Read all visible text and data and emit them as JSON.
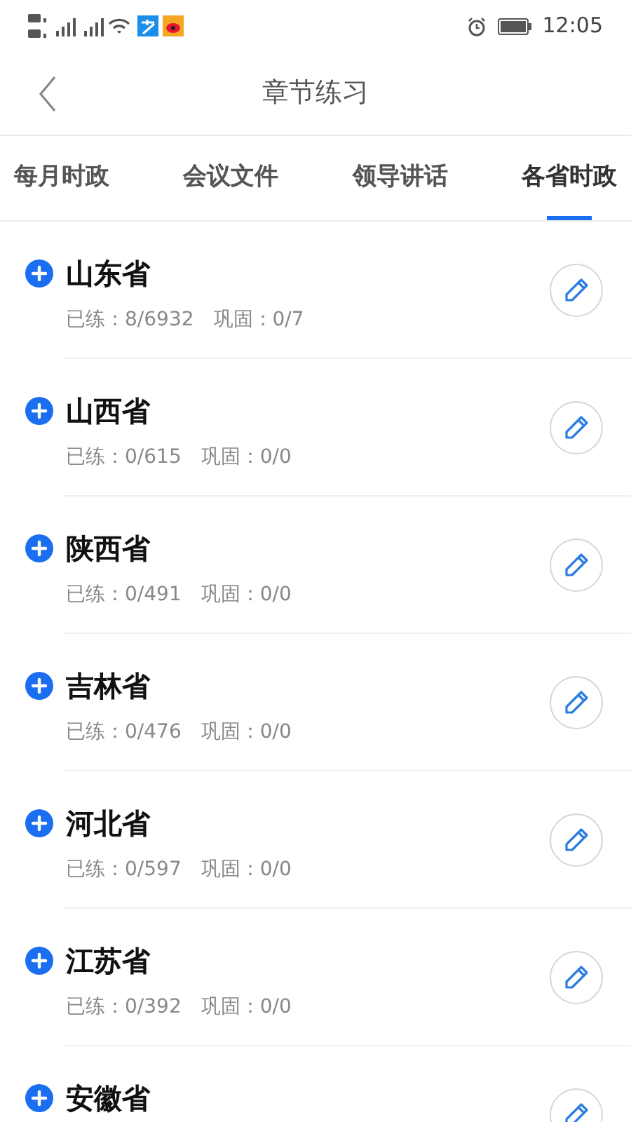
{
  "status_bar": {
    "time": "12:05"
  },
  "header": {
    "title": "章节练习"
  },
  "tabs": [
    {
      "label": "每月时政",
      "selected": false
    },
    {
      "label": "会议文件",
      "selected": false
    },
    {
      "label": "领导讲话",
      "selected": false
    },
    {
      "label": "各省时政",
      "selected": true
    }
  ],
  "provinces": [
    {
      "name": "山东省",
      "practiced_label": "已练：",
      "practiced": "8/6932",
      "review_label": "巩固：",
      "review": "0/7"
    },
    {
      "name": "山西省",
      "practiced_label": "已练：",
      "practiced": "0/615",
      "review_label": "巩固：",
      "review": "0/0"
    },
    {
      "name": "陕西省",
      "practiced_label": "已练：",
      "practiced": "0/491",
      "review_label": "巩固：",
      "review": "0/0"
    },
    {
      "name": "吉林省",
      "practiced_label": "已练：",
      "practiced": "0/476",
      "review_label": "巩固：",
      "review": "0/0"
    },
    {
      "name": "河北省",
      "practiced_label": "已练：",
      "practiced": "0/597",
      "review_label": "巩固：",
      "review": "0/0"
    },
    {
      "name": "江苏省",
      "practiced_label": "已练：",
      "practiced": "0/392",
      "review_label": "巩固：",
      "review": "0/0"
    },
    {
      "name": "安徽省"
    }
  ]
}
